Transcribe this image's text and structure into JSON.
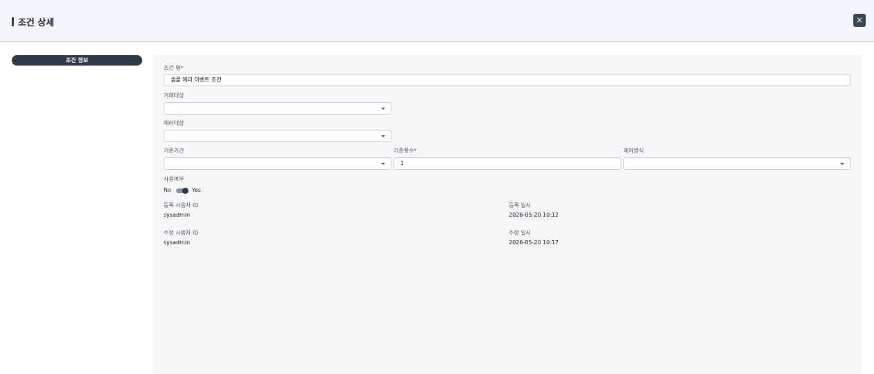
{
  "header": {
    "title": "조건 상세",
    "close_icon": "×"
  },
  "sidebar": {
    "section_label": "조건 정보"
  },
  "form": {
    "name": {
      "label": "조건 명*",
      "value": "샘플 에러 이벤트 조건"
    },
    "trade_target": {
      "label": "거래대상",
      "value": ""
    },
    "error_target": {
      "label": "에러대상",
      "value": ""
    },
    "base_period": {
      "label": "기준기간",
      "value": ""
    },
    "base_count": {
      "label": "기준횟수*",
      "value": "1"
    },
    "control_method": {
      "label": "제어방식",
      "value": ""
    },
    "use_flag": {
      "label": "사용여부",
      "off_label": "No",
      "on_label": "Yes",
      "state": "on"
    }
  },
  "meta": {
    "reg_user": {
      "label": "등록 사용자 ID",
      "value": "sysadmin"
    },
    "reg_date": {
      "label": "등록 일시",
      "value": "2026-05-20 10:12"
    },
    "mod_user": {
      "label": "수정 사용자 ID",
      "value": "sysadmin"
    },
    "mod_date": {
      "label": "수정 일시",
      "value": "2026-05-20 10:17"
    }
  },
  "colors": {
    "accent": "#2f3a48",
    "panel_bg": "#f7f8fa",
    "header_bg": "#f1f4f8"
  }
}
